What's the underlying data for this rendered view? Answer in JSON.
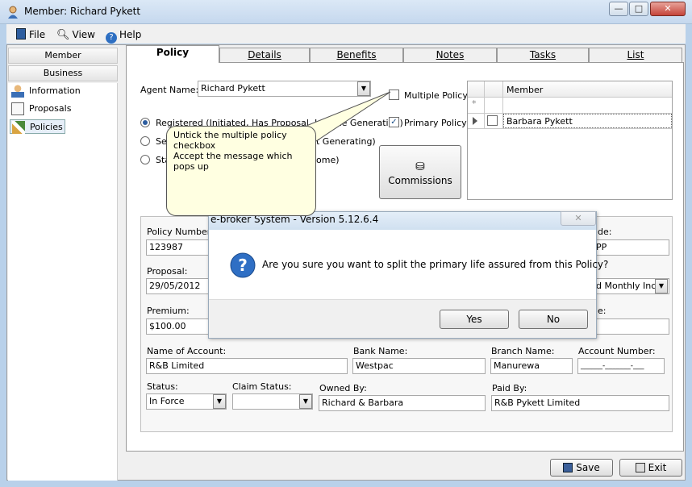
{
  "window": {
    "title": "Member: Richard Pykett",
    "close": "✕",
    "minimize": "—",
    "maximize": "□"
  },
  "menu": {
    "file": "File",
    "view": "View",
    "help": "Help"
  },
  "nav": {
    "member": "Member",
    "business": "Business",
    "items": [
      {
        "label": "Information",
        "icon": "person-icon"
      },
      {
        "label": "Proposals",
        "icon": "proposal-icon"
      },
      {
        "label": "Policies",
        "icon": "policy-icon"
      }
    ]
  },
  "tabs": [
    "Policy",
    "Details",
    "Benefits",
    "Notes",
    "Tasks",
    "List"
  ],
  "policy": {
    "agent_label": "Agent Name:",
    "agent_value": "Richard Pykett",
    "multiple_policy": "Multiple Policy",
    "primary_policy": "Primary Policy",
    "radio1": "Registered (Initiated, Has Proposal, Income Generating)",
    "radio2_start": "Se",
    "radio2_end": "t Generating)",
    "radio3_start": "Sta",
    "radio3_end": "ome)",
    "commissions": "Commissions",
    "grid_header": "Member",
    "grid_row": "Barbara Pykett",
    "new_row_marker": "*"
  },
  "callout": {
    "line1": "Untick the multiple policy checkbox",
    "line2": "Accept the message which pops up"
  },
  "fields": {
    "policy_number_label": "Policy Number:",
    "policy_number": "123987",
    "proposal_label": "Proposal:",
    "proposal": "29/05/2012",
    "premium_label": "Premium:",
    "premium": "$100.00",
    "right_code_label": "de:",
    "right_code": "PP",
    "frequency": "d Monthly Inco",
    "right3_label": "e:",
    "account_name_label": "Name of Account:",
    "account_name": "R&B Limited",
    "bank_name_label": "Bank Name:",
    "bank_name": "Westpac",
    "branch_name_label": "Branch Name:",
    "branch_name": "Manurewa",
    "account_number_label": "Account Number:",
    "account_number": "______-_______-___",
    "status_label": "Status:",
    "status": "In Force",
    "claim_status_label": "Claim Status:",
    "owned_by_label": "Owned By:",
    "owned_by": "Richard & Barbara",
    "paid_by_label": "Paid By:",
    "paid_by": "R&B Pykett Limited"
  },
  "dialog": {
    "title": "e-broker System - Version 5.12.6.4",
    "message": "Are you sure you want to split the primary life assured from this Policy?",
    "yes": "Yes",
    "no": "No",
    "close": "✕"
  },
  "footer": {
    "save": "Save",
    "exit": "Exit"
  }
}
